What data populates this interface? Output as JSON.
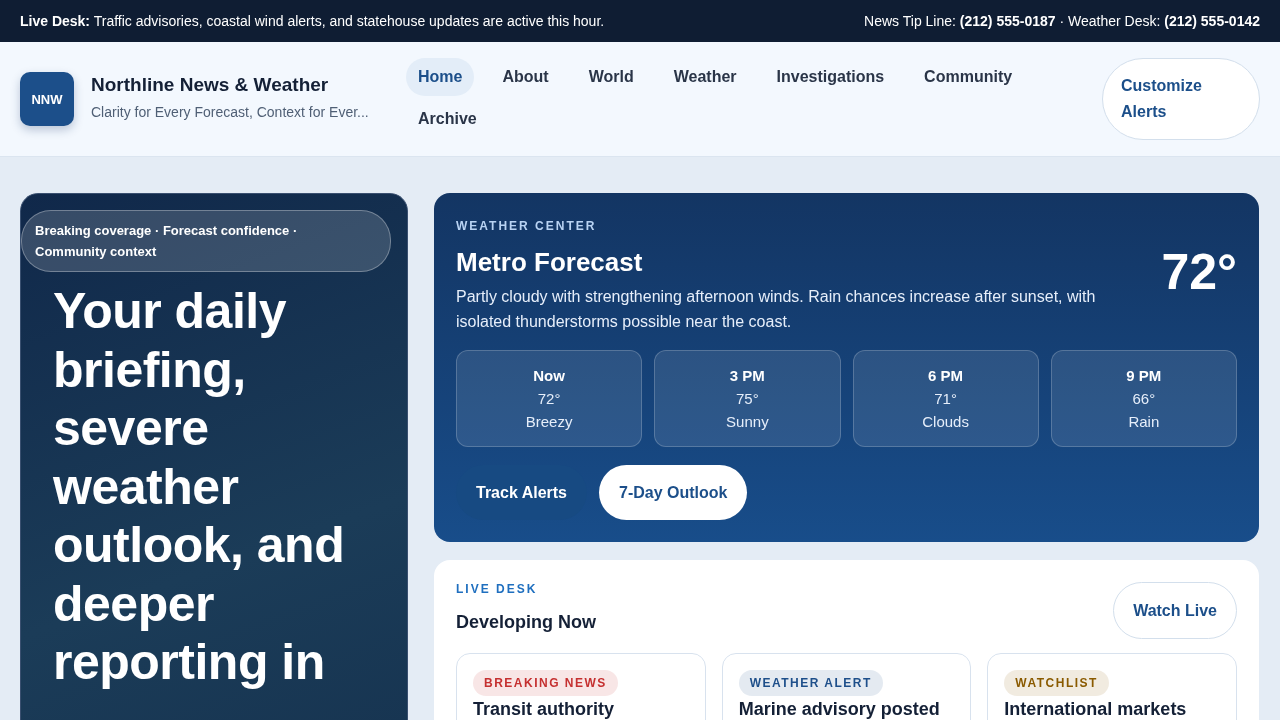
{
  "top_bar": {
    "label": "Live Desk:",
    "message": "Traffic advisories, coastal wind alerts, and statehouse updates are active this hour.",
    "contacts": [
      {
        "label": "News Tip Line:",
        "value": "(212) 555-0187"
      },
      {
        "label": "Weather Desk:",
        "value": "(212) 555-0142"
      }
    ],
    "separator": "·"
  },
  "header": {
    "logo": "NNW",
    "title": "Northline News & Weather",
    "tagline": "Clarity for Every Forecast, Context for Ever...",
    "nav": [
      {
        "label": "Home",
        "selected": true
      },
      {
        "label": "About",
        "selected": false
      },
      {
        "label": "World",
        "selected": false
      },
      {
        "label": "Weather",
        "selected": false
      },
      {
        "label": "Investigations",
        "selected": false
      },
      {
        "label": "Community",
        "selected": false
      },
      {
        "label": "Archive",
        "selected": false
      }
    ],
    "cta": "Customize Alerts"
  },
  "hero": {
    "pill": "Breaking coverage · Forecast confidence · Community context",
    "headline": "Your daily briefing, severe weather outlook, and deeper reporting in"
  },
  "weather": {
    "eyebrow": "WEATHER CENTER",
    "title": "Metro Forecast",
    "summary": "Partly cloudy with strengthening afternoon winds. Rain chances increase after sunset, with isolated thunderstorms possible near the coast.",
    "temperature": "72°",
    "hours": [
      {
        "time": "Now",
        "temp": "72°",
        "condition": "Breezy"
      },
      {
        "time": "3 PM",
        "temp": "75°",
        "condition": "Sunny"
      },
      {
        "time": "6 PM",
        "temp": "71°",
        "condition": "Clouds"
      },
      {
        "time": "9 PM",
        "temp": "66°",
        "condition": "Rain"
      }
    ],
    "buttons": [
      {
        "label": "Track Alerts",
        "kind": "primary"
      },
      {
        "label": "7-Day Outlook",
        "kind": "secondary"
      }
    ]
  },
  "live_desk": {
    "eyebrow": "LIVE DESK",
    "title": "Developing Now",
    "button": "Watch Live",
    "stories": [
      {
        "tag": "BREAKING NEWS",
        "color": "#c53030",
        "headline": "Transit authority"
      },
      {
        "tag": "WEATHER ALERT",
        "color": "#1e4f8a",
        "headline": "Marine advisory posted"
      },
      {
        "tag": "WATCHLIST",
        "color": "#8a5a00",
        "headline": "International markets"
      }
    ]
  }
}
